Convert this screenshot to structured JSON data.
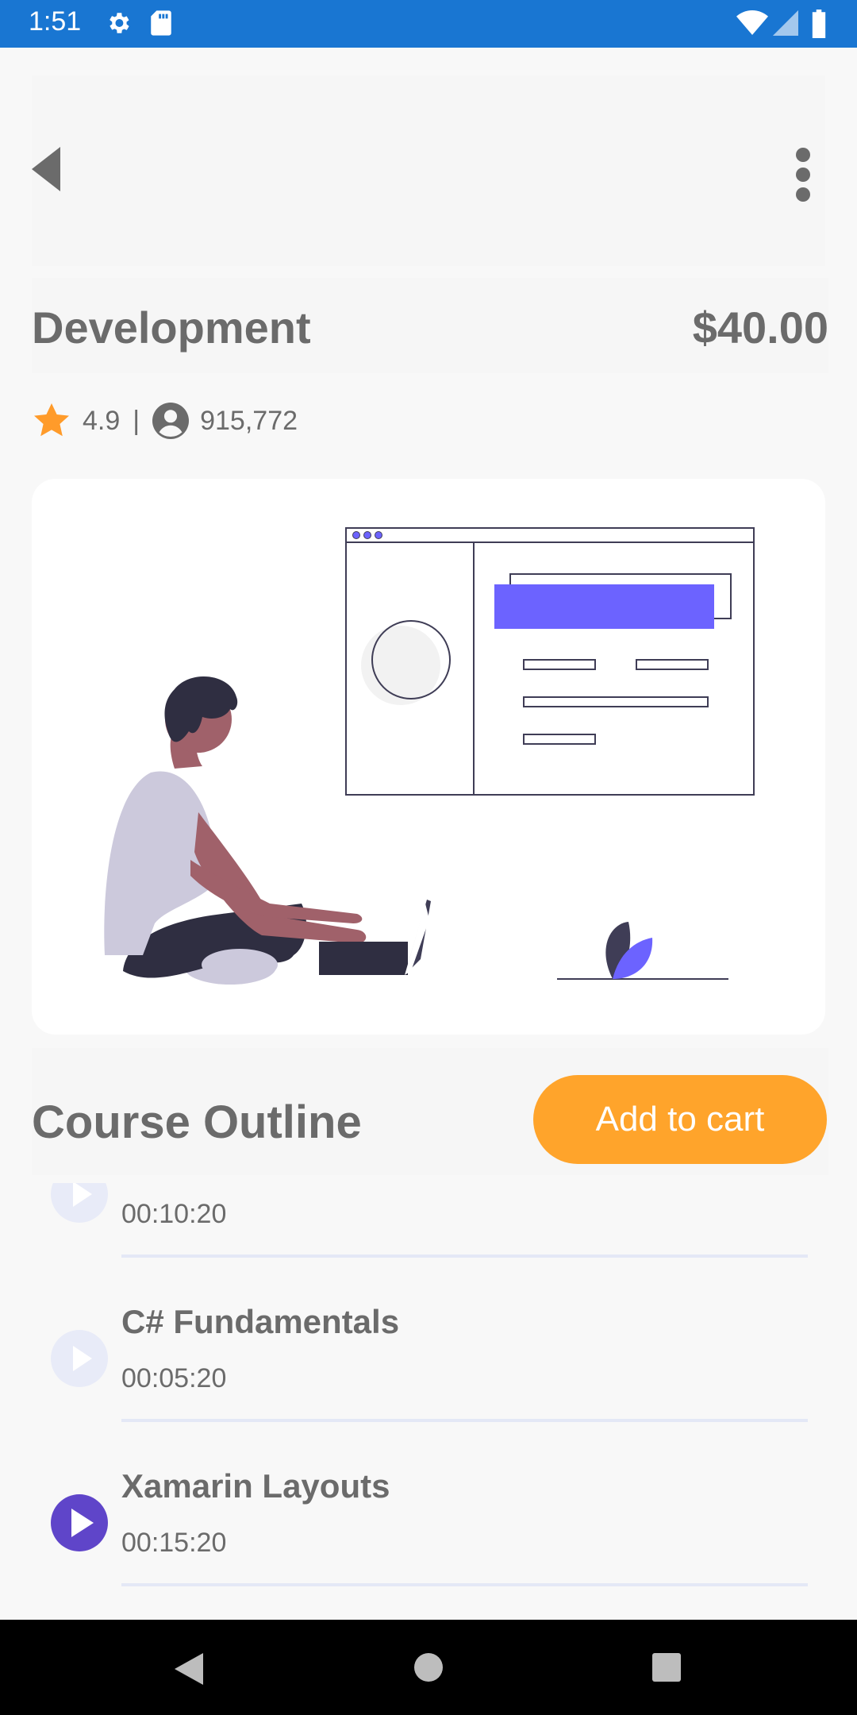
{
  "status_bar": {
    "time": "1:51",
    "left_icons": [
      "gear-icon",
      "sd-card-icon"
    ],
    "right_icons": [
      "wifi-icon",
      "signal-icon",
      "battery-icon"
    ],
    "color": "#1976d2"
  },
  "toolbar": {
    "back_icon": "chevron-left-icon",
    "menu_icon": "more-vertical-icon"
  },
  "course": {
    "title": "Development",
    "price": "$40.00",
    "rating": "4.9",
    "separator": "|",
    "enrolled": "915,772"
  },
  "outline": {
    "title": "Course Outline",
    "add_to_cart_label": "Add to cart",
    "accent": "#ffa42b",
    "lessons": [
      {
        "title": "",
        "duration": "00:10:20",
        "state": "inactive"
      },
      {
        "title": "C# Fundamentals",
        "duration": "00:05:20",
        "state": "inactive"
      },
      {
        "title": "Xamarin Layouts",
        "duration": "00:15:20",
        "state": "active"
      }
    ],
    "active_color": "#5f45c9",
    "inactive_color": "#e8ebf8"
  },
  "nav_bar": {
    "icons": [
      "back-triangle-icon",
      "home-circle-icon",
      "recents-square-icon"
    ]
  }
}
